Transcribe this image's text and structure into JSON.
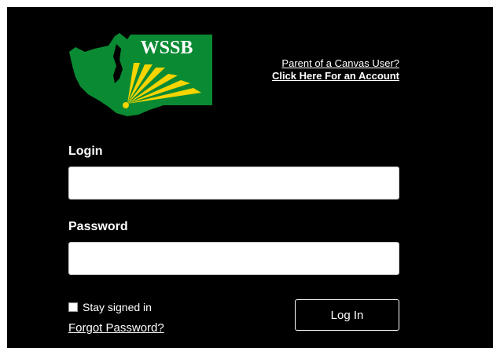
{
  "logo": {
    "text": "WSSB",
    "colors": {
      "green": "#0a8a33",
      "yellow": "#f5d400",
      "white": "#ffffff"
    }
  },
  "parent_links": {
    "line1": "Parent of a Canvas User?",
    "line2": "Click Here For an Account"
  },
  "login": {
    "label": "Login",
    "value": "",
    "placeholder": ""
  },
  "password": {
    "label": "Password",
    "value": "",
    "placeholder": ""
  },
  "remember": {
    "label": "Stay signed in",
    "checked": false
  },
  "forgot_link": "Forgot Password?",
  "submit_label": "Log In"
}
